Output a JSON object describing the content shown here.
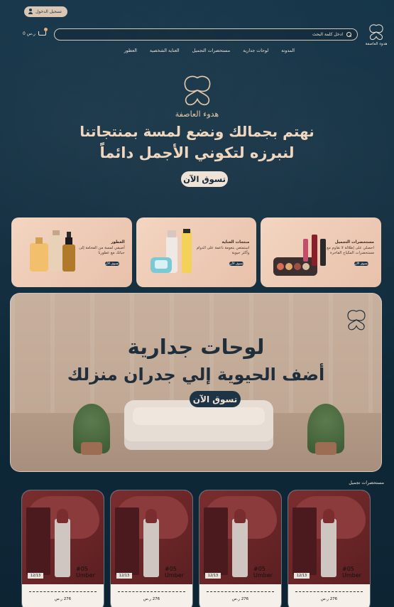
{
  "header": {
    "login_label": "تسجيل الدخول",
    "cart_amount": "0 ر.س",
    "search_placeholder": "ادخل كلمة البحث",
    "brand_name": "هدوء العاصفة"
  },
  "nav": {
    "items": [
      {
        "label": "المدونة"
      },
      {
        "label": "لوحات جدارية"
      },
      {
        "label": "مستحضرات التجميل"
      },
      {
        "label": "العناية الشخصية"
      },
      {
        "label": "العطور"
      }
    ]
  },
  "hero": {
    "brand": "هدوء العاصفة",
    "line1": "نهتم بجمالك ونضع لمسة بمنتجاتنا",
    "line2": "لنبرزه لتكوني الأجمل دائماً",
    "cta": "تسوق الآن"
  },
  "cards": [
    {
      "title": "العطور",
      "desc": "أضيفي لمسة من الفخامة إلى حياتك مع عطورنا",
      "cta": "تسوق الآن"
    },
    {
      "title": "منتجات العناية",
      "desc": "استمتعي بنعومة ناعمة على الدوام وأكثر حيوية",
      "cta": "تسوق الآن"
    },
    {
      "title": "مستحضرات التجميل",
      "desc": "احصلي على إطلالة لا تقاوم مع مستحضرات المكياج الفاخرة",
      "cta": "تسوق الآن"
    }
  ],
  "banner": {
    "title": "لوحات جدارية",
    "subtitle": "أضف الحيوية إلي جدران منزلك",
    "cta": "تسوق الآن"
  },
  "products_section": {
    "title": "مستحضرات تجميل",
    "items": [
      {
        "shade": "#05 Umber",
        "tag": "12/13",
        "price": "276 ر.س"
      },
      {
        "shade": "#05 Umber",
        "tag": "12/13",
        "price": "276 ر.س"
      },
      {
        "shade": "#05 Umber",
        "tag": "12/13",
        "price": "276 ر.س"
      },
      {
        "shade": "#05 Umber",
        "tag": "12/13",
        "price": "276 ر.س"
      }
    ]
  },
  "colors": {
    "background": "#0f2a3a",
    "accent": "#efe3d6",
    "text": "#f1e3d4"
  }
}
